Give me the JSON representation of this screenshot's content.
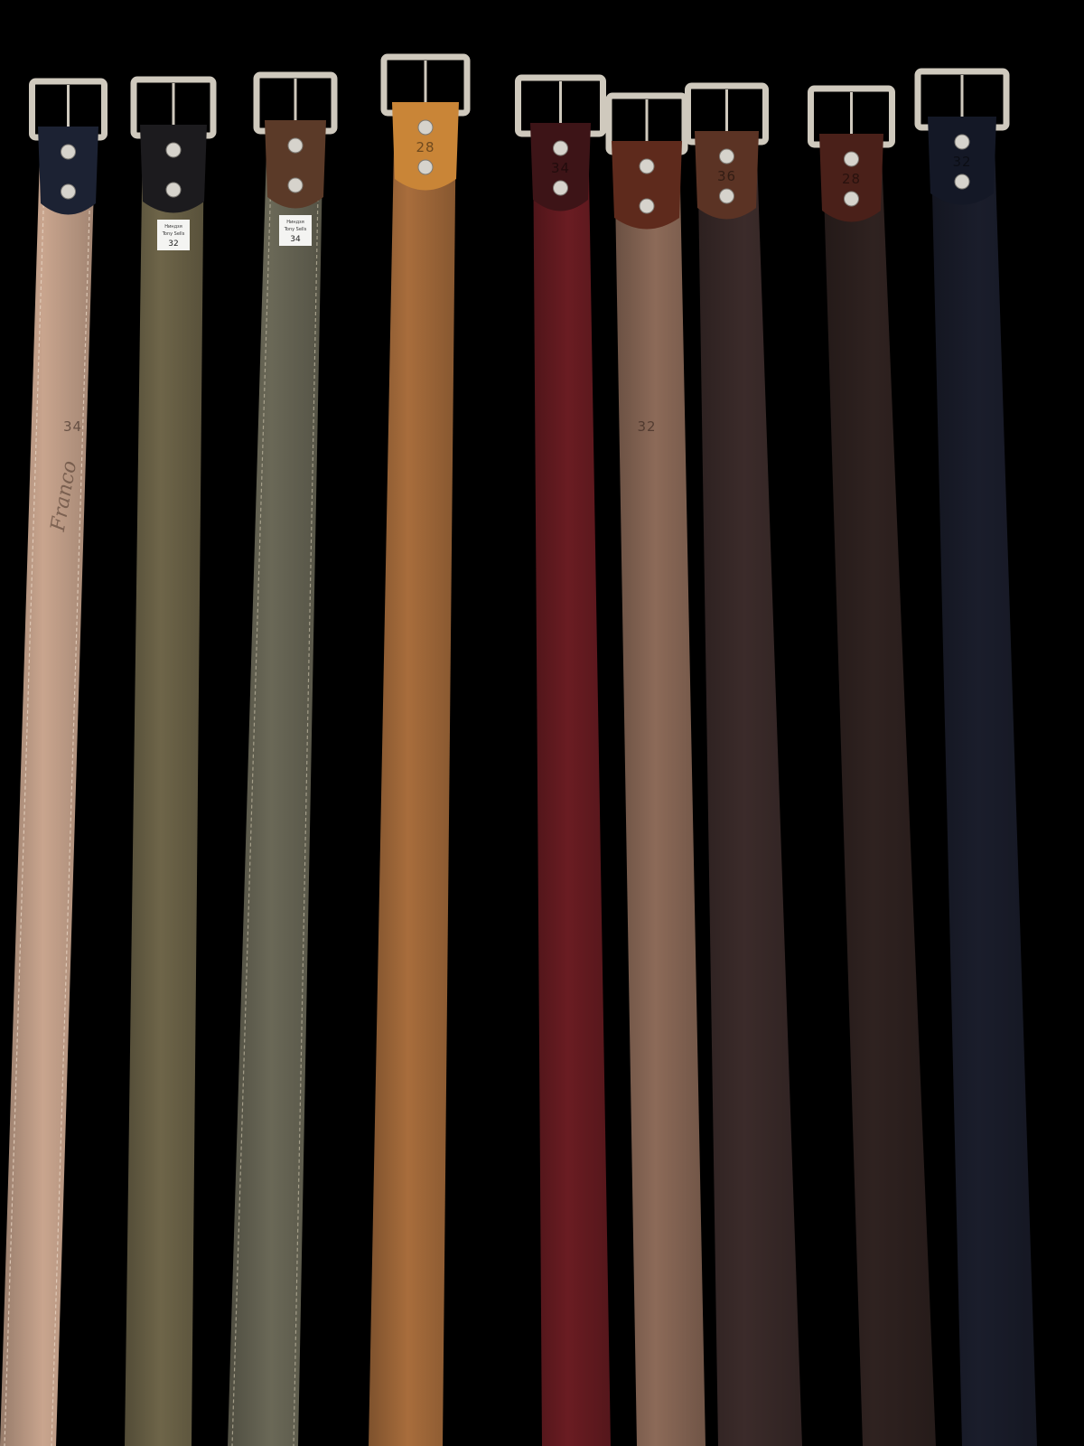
{
  "photo": {
    "background_color": "#000000",
    "belts": [
      {
        "leather_color": "#c9a58e",
        "tab_color": "#1c2233",
        "stitched": true,
        "stitch_color": "#e8d4c2",
        "imprints": {
          "size": "34",
          "brand": "Franco"
        }
      },
      {
        "leather_color": "#6e6549",
        "tab_color": "#1c1b1e",
        "stitched": false,
        "stitch_color": "#8f8563",
        "label_tag": {
          "line1": "Ниндзя",
          "line2": "Tony Sells",
          "size": "32"
        }
      },
      {
        "leather_color": "#6a6857",
        "tab_color": "#5b3a28",
        "stitched": true,
        "stitch_color": "#b7b09a",
        "label_tag": {
          "line1": "Ниндзя",
          "line2": "Tony Sells",
          "size": "34"
        }
      },
      {
        "leather_color": "#a86d3c",
        "tab_color": "#c98537",
        "stitched": false,
        "stitch_color": "#a86d3c",
        "tab_number": "28"
      },
      {
        "leather_color": "#6a1c22",
        "tab_color": "#3d1417",
        "stitched": false,
        "stitch_color": "#6a1c22",
        "tab_number": "34"
      },
      {
        "leather_color": "#8c6a58",
        "tab_color": "#5e2a1c",
        "stitched": false,
        "stitch_color": "#8c6a58",
        "imprints": {
          "size": "32"
        }
      },
      {
        "leather_color": "#3b2b2a",
        "tab_color": "#5b3324",
        "stitched": false,
        "stitch_color": "#3b2b2a",
        "tab_number": "36"
      },
      {
        "leather_color": "#2f2220",
        "tab_color": "#4a2019",
        "stitched": false,
        "stitch_color": "#2f2220",
        "tab_number": "28"
      },
      {
        "leather_color": "#1a1d2b",
        "tab_color": "#141826",
        "stitched": false,
        "stitch_color": "#1a1d2b",
        "tab_number": "32"
      }
    ],
    "buckle_color": "#cfc9bd",
    "rivet_color": "#d6d3cc"
  }
}
